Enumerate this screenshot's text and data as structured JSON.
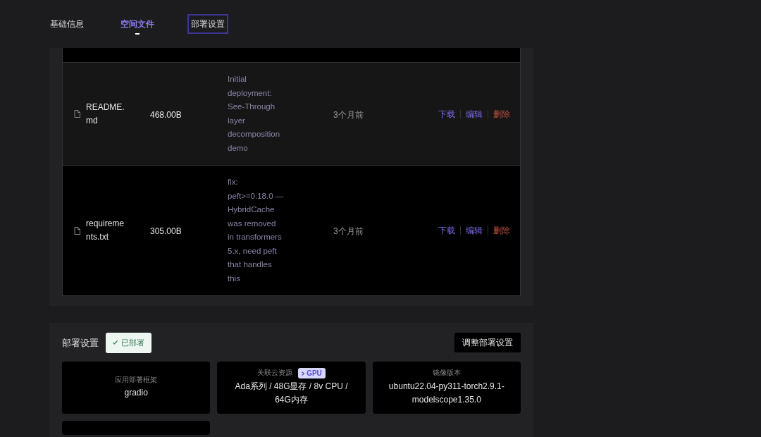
{
  "tabs": [
    {
      "label": "基础信息",
      "selected": false,
      "focused": false
    },
    {
      "label": "空间文件",
      "selected": true,
      "focused": false
    },
    {
      "label": "部署设置",
      "selected": false,
      "focused": true
    }
  ],
  "files": [
    {
      "name": "README.md",
      "size": "468.00B",
      "message": "Initial deployment: See-Through layer decomposition demo",
      "time": "3个月前",
      "actions": [
        "下载",
        "编辑",
        "删除"
      ]
    },
    {
      "name": "requirements.txt",
      "size": "305.00B",
      "message": "fix: peft>=0.18.0 — HybridCache was removed in transformers 5.x, need peft that handles this",
      "time": "3个月前",
      "actions": [
        "下载",
        "编辑",
        "删除"
      ]
    }
  ],
  "deploy": {
    "title": "部署设置",
    "status": "已部署",
    "adjust_button": "调整部署设置",
    "cards": [
      {
        "label": "应用部署框架",
        "value": "gradio"
      },
      {
        "label": "关联云资源",
        "badge": "GPU",
        "value": "Ada系列 / 48G显存 / 8v CPU / 64G内存"
      },
      {
        "label": "镜像版本",
        "value": "ubuntu22.04-py311-torch2.9.1-modelscope1.35.0"
      }
    ]
  }
}
